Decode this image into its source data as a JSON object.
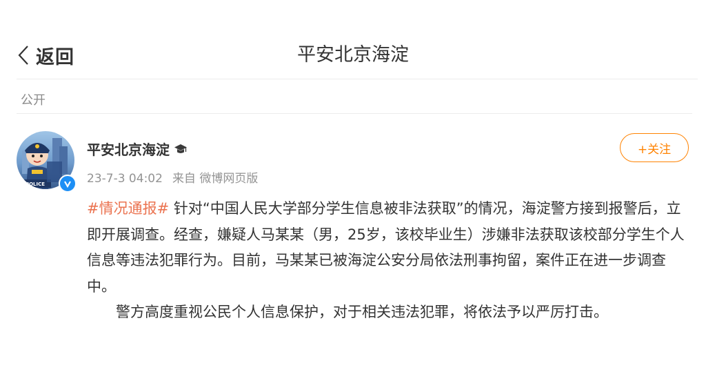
{
  "header": {
    "back_label": "返回",
    "title": "平安北京海淀"
  },
  "visibility": "公开",
  "post": {
    "username": "平安北京海淀",
    "timestamp": "23-7-3 04:02",
    "source": "来自 微博网页版",
    "follow_label": "+关注",
    "hashtag": "#情况通报#",
    "paragraph1": " 针对“中国人民大学部分学生信息被非法获取”的情况，海淀警方接到报警后，立即开展调查。经查，嫌疑人马某某（男，25岁，该校毕业生）涉嫌非法获取该校部分学生个人信息等违法犯罪行为。目前，马某某已被海淀公安分局依法刑事拘留，案件正在进一步调查中。",
    "paragraph2": "警方高度重视公民个人信息保护，对于相关违法犯罪，将依法予以严厉打击。",
    "avatar_text": "POLICE"
  },
  "colors": {
    "accent": "#ff8200",
    "hashtag": "#eb7350",
    "verified": "#1d8ff5"
  }
}
